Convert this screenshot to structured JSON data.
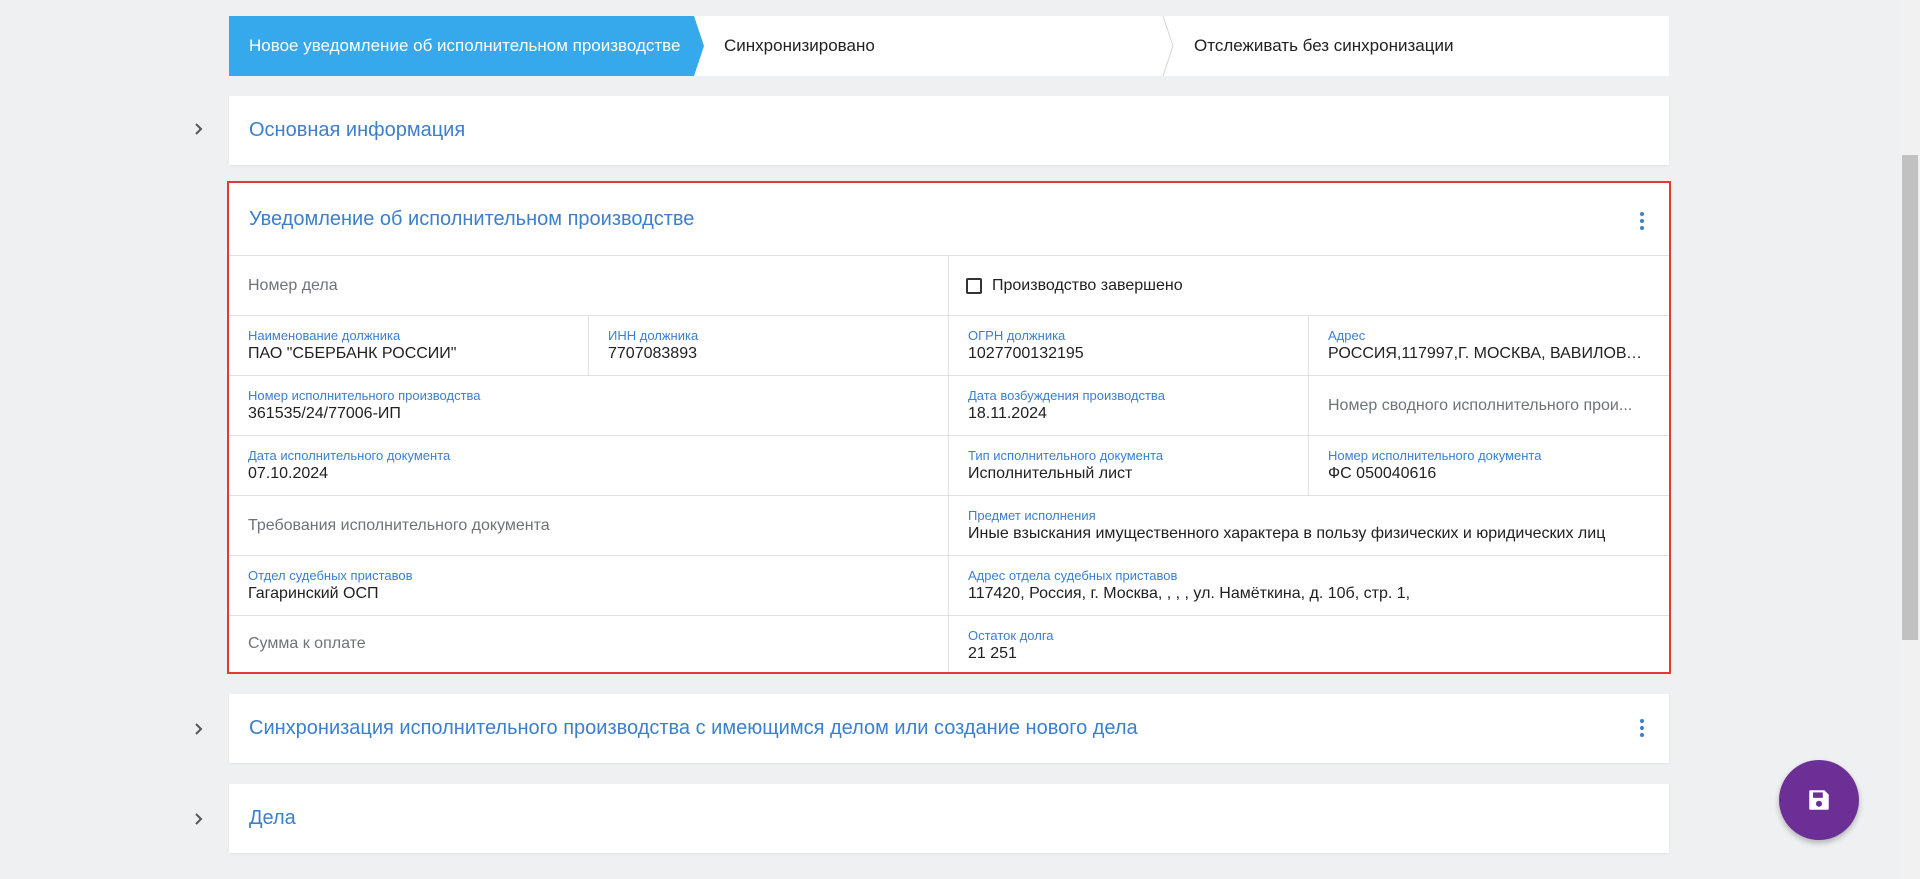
{
  "stepper": {
    "steps": [
      {
        "label": "Новое уведомление об исполнительном производстве"
      },
      {
        "label": "Синхронизировано"
      },
      {
        "label": "Отслеживать без синхронизации"
      }
    ]
  },
  "sections": {
    "basic_info": {
      "title": "Основная информация"
    },
    "notice": {
      "title": "Уведомление об исполнительном производстве"
    },
    "sync": {
      "title": "Синхронизация исполнительного производства с имеющимся делом или создание нового дела"
    },
    "cases": {
      "title": "Дела"
    }
  },
  "form": {
    "case_number": {
      "placeholder": "Номер дела"
    },
    "finished": {
      "label": "Производство завершено",
      "checked": false
    },
    "debtor_name": {
      "label": "Наименование должника",
      "value": "ПАО \"СБЕРБАНК РОССИИ\""
    },
    "debtor_inn": {
      "label": "ИНН должника",
      "value": "7707083893"
    },
    "debtor_ogrn": {
      "label": "ОГРН должника",
      "value": "1027700132195"
    },
    "address": {
      "label": "Адрес",
      "value": "РОССИЯ,117997,Г. МОСКВА, ВАВИЛОВА ..."
    },
    "proceeding_number": {
      "label": "Номер исполнительного производства",
      "value": "361535/24/77006-ИП"
    },
    "initiation_date": {
      "label": "Дата возбуждения производства",
      "value": "18.11.2024"
    },
    "consolidated_number": {
      "placeholder": "Номер сводного исполнительного прои..."
    },
    "document_date": {
      "label": "Дата исполнительного документа",
      "value": "07.10.2024"
    },
    "document_type": {
      "label": "Тип исполнительного документа",
      "value": "Исполнительный лист"
    },
    "document_number": {
      "label": "Номер исполнительного документа",
      "value": "ФС 050040616"
    },
    "requirements": {
      "placeholder": "Требования исполнительного документа"
    },
    "subject": {
      "label": "Предмет исполнения",
      "value": "Иные взыскания имущественного характера в пользу физических и юридических лиц"
    },
    "bailiff_department": {
      "label": "Отдел судебных приставов",
      "value": "Гагаринский ОСП"
    },
    "bailiff_address": {
      "label": "Адрес отдела судебных приставов",
      "value": "117420, Россия, г. Москва, , , , ул. Намёткина, д. 10б, стр. 1,"
    },
    "amount_due": {
      "placeholder": "Сумма к оплате"
    },
    "debt_balance": {
      "label": "Остаток долга",
      "value": "21 251"
    }
  },
  "colors": {
    "accent": "#36a9ec",
    "link": "#3c7fcc",
    "fab": "#6b2f96",
    "highlight_border": "#e53935"
  },
  "icons": {
    "fab": "save-icon",
    "expand": "chevron-right-icon",
    "menu": "more-vertical-icon"
  }
}
